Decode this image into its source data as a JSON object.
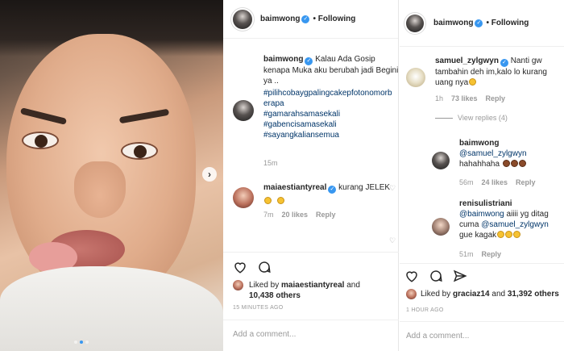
{
  "post": {
    "carousel_dots": 3,
    "carousel_active": 1
  },
  "panel1": {
    "header": {
      "username": "baimwong",
      "follow_label": "• Following"
    },
    "caption": {
      "username": "baimwong",
      "text": "Kalau Ada Gosip kenapa Muka aku berubah jadi Begini ya ..",
      "hashtags": [
        "#pilihcobaygpalingcakepfotonomorb",
        "erapa",
        "#gamarahsamasekali",
        "#gabencisamasekali",
        "#sayangkaliansemua"
      ],
      "time": "15m"
    },
    "comment": {
      "username": "maiaestiantyreal",
      "text": "kurang JELEK",
      "time": "7m",
      "likes": "20 likes",
      "reply": "Reply"
    },
    "liked_by": {
      "prefix": "Liked by ",
      "user": "maiaestiantyreal",
      "and": " and",
      "others": "10,438 others"
    },
    "timestamp": "15 MINUTES AGO",
    "add_comment": "Add a comment..."
  },
  "panel2": {
    "header": {
      "username": "baimwong",
      "follow_label": "• Following"
    },
    "comments": [
      {
        "username": "samuel_zylgwyn",
        "text_1": "Nanti gw",
        "text_2": "tambahin deh im,kalo lo kurang",
        "text_3": "uang nya",
        "time": "1h",
        "likes": "73 likes",
        "reply": "Reply"
      },
      {
        "username": "baimwong",
        "mention": "@samuel_zylgwyn",
        "text": "hahahhaha",
        "time": "56m",
        "likes": "24 likes",
        "reply": "Reply"
      },
      {
        "username": "renisulistriani",
        "mention_1": "@baimwong",
        "text_1": " aiiii yg ditag",
        "text_2": "cuma ",
        "mention_2": "@samuel_zylgwyn",
        "text_3": "gue kagak",
        "time": "51m",
        "reply": "Reply"
      }
    ],
    "view_replies": "View replies (4)",
    "liked_by": {
      "prefix": "Liked by ",
      "user": "graciaz14",
      "and": " and ",
      "others": "31,392 others"
    },
    "timestamp": "1 HOUR AGO",
    "add_comment": "Add a comment..."
  },
  "colors": {
    "verified": "#3897f0",
    "hashtag": "#003569",
    "muted": "#999999"
  }
}
